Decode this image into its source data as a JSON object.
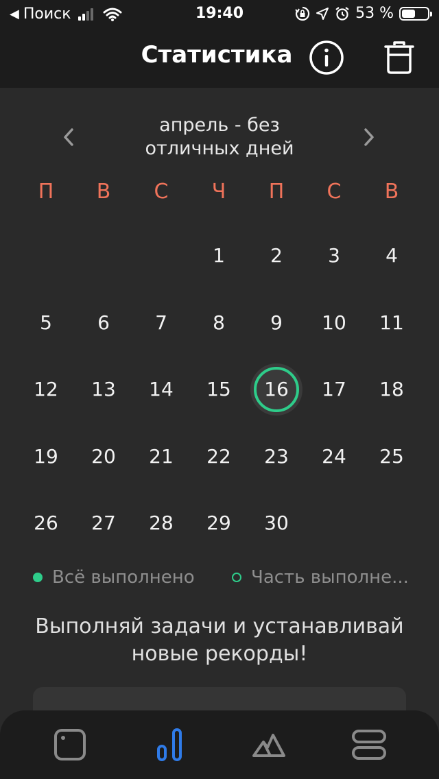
{
  "status_bar": {
    "back_arrow": "◀",
    "carrier": "Поиск",
    "time": "19:40",
    "battery_percent": "53 %",
    "battery_level": 0.53,
    "icons": [
      "signal-icon",
      "wifi-icon",
      "orientation-lock-icon",
      "location-icon",
      "alarm-icon",
      "battery-icon"
    ]
  },
  "header": {
    "title": "Статистика",
    "info_icon": "info-icon",
    "trash_icon": "trash-icon"
  },
  "month_nav": {
    "title_line1": "апрель - без",
    "title_line2": "отличных дней",
    "prev_icon": "chevron-left-icon",
    "next_icon": "chevron-right-icon"
  },
  "calendar": {
    "weekdays": [
      "П",
      "В",
      "С",
      "Ч",
      "П",
      "С",
      "В"
    ],
    "leading_blanks": 3,
    "days": [
      "1",
      "2",
      "3",
      "4",
      "5",
      "6",
      "7",
      "8",
      "9",
      "10",
      "11",
      "12",
      "13",
      "14",
      "15",
      "16",
      "17",
      "18",
      "19",
      "20",
      "21",
      "22",
      "23",
      "24",
      "25",
      "26",
      "27",
      "28",
      "29",
      "30"
    ],
    "today": "16"
  },
  "legend": {
    "all_done": "Всё выполнено",
    "partial": "Часть выполне..."
  },
  "motivation": {
    "line1": "Выполняй задачи и устанавливай",
    "line2": "новые рекорды!"
  },
  "tabbar": {
    "tabs": [
      {
        "icon": "tasks-icon",
        "active": false
      },
      {
        "icon": "statistics-icon",
        "active": true
      },
      {
        "icon": "mountain-icon",
        "active": false
      },
      {
        "icon": "menu-icon",
        "active": false
      }
    ]
  },
  "colors": {
    "background": "#2a2a2a",
    "topbar": "#1c1c1c",
    "weekday": "#f0735a",
    "accent_green": "#2ecc8a",
    "active_tab": "#2f7be8",
    "inactive_tab": "#8a8a8a"
  }
}
